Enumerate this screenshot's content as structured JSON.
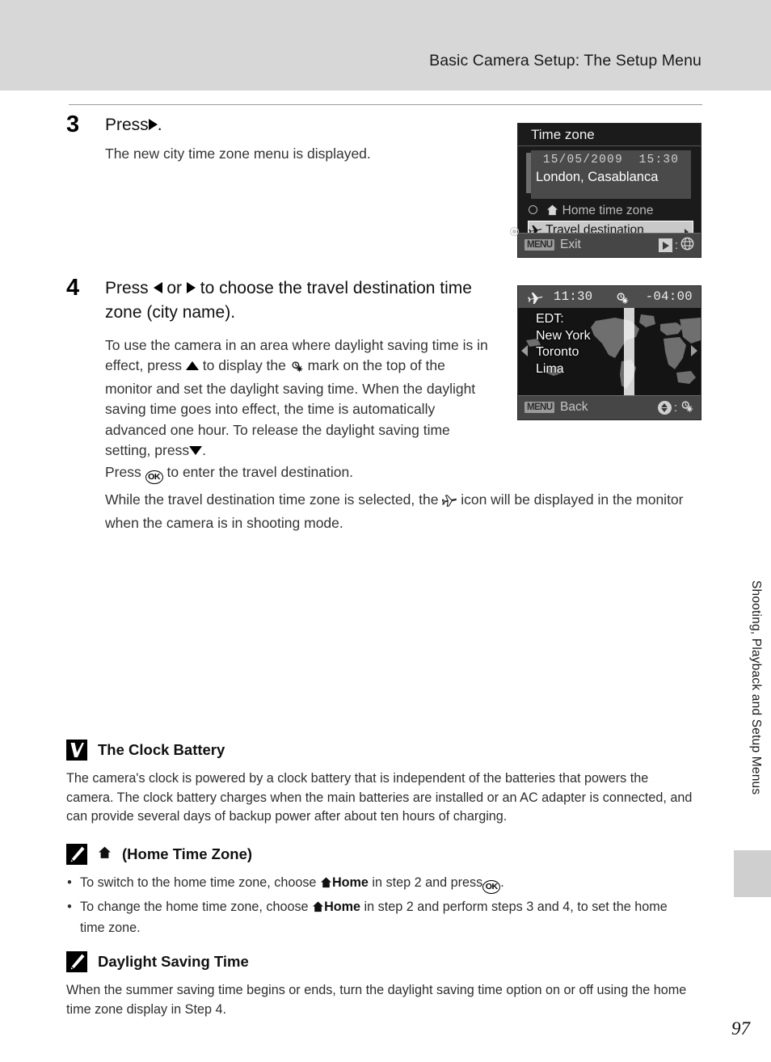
{
  "header": {
    "title": "Basic Camera Setup: The Setup Menu"
  },
  "steps": [
    {
      "number": "3",
      "title_prefix": "Press",
      "title_suffix": ".",
      "title_icon": "right-arrow",
      "text": "The new city time zone menu is displayed."
    },
    {
      "number": "4",
      "title_part1": "Press",
      "title_part2": "or",
      "title_part3": "to choose the travel destination time zone (city name).",
      "paragraph_1a": "To use the camera in an area where daylight saving time is in effect, press",
      "paragraph_1b": "to display the",
      "paragraph_1c": "mark on the top of the monitor and set the daylight saving time. When the daylight saving time goes into effect, the time is automatically advanced one hour. To release the daylight saving time setting, press",
      "paragraph_1d": "."
    }
  ],
  "press_ok": {
    "before": "Press",
    "after": "to enter the travel destination.",
    "ok_label": "OK"
  },
  "travel_note": {
    "before": "While the travel destination time zone is selected, the",
    "after": "icon will be displayed in the monitor when the camera is in shooting mode."
  },
  "lcd_timezone": {
    "title": "Time zone",
    "date": "15/05/2009",
    "time": "15:30",
    "city": "London, Casablanca",
    "option_home": "Home time zone",
    "option_travel": "Travel destination",
    "menu_badge": "MENU",
    "bottom_label": "Exit",
    "bottom_right_separator": ":",
    "bottom_right_icon": "globe-icon"
  },
  "lcd_worldmap": {
    "plane_icon": "airplane-icon",
    "time": "11:30",
    "dst_icon": "daylight-saving-icon",
    "utc_offset": "-04:00",
    "cities": [
      "EDT:",
      "New York",
      "Toronto",
      "Lima"
    ],
    "menu_badge": "MENU",
    "bottom_label": "Back",
    "bottom_right_separator": ":",
    "bottom_right_icon": "daylight-saving-icon"
  },
  "notes": [
    {
      "icon": "caution-check-icon",
      "title": "The Clock Battery",
      "body": "The camera's clock is powered by a clock battery that is independent of the batteries that powers the camera. The clock battery charges when the main batteries are installed or an AC adapter is connected, and can provide several days of backup power after about ten hours of charging."
    },
    {
      "icon": "pencil-note-icon",
      "title": "(Home Time Zone)",
      "title_icon": "home-icon",
      "bullets": [
        {
          "part1": "To switch to the home time zone, choose",
          "bold": "Home",
          "part2": "in step 2 and press",
          "part3": "."
        },
        {
          "part1": "To change the home time zone, choose",
          "bold": "Home",
          "part2": "in step 2 and perform steps 3 and 4, to set the home time zone.",
          "part3": ""
        }
      ]
    },
    {
      "icon": "pencil-note-icon",
      "title": "Daylight Saving Time",
      "body": "When the summer saving time begins or ends, turn the daylight saving time option on or off using the home time zone display in Step 4."
    }
  ],
  "side_tab": {
    "label": "Shooting, Playback and Setup Menus"
  },
  "page_number": "97"
}
